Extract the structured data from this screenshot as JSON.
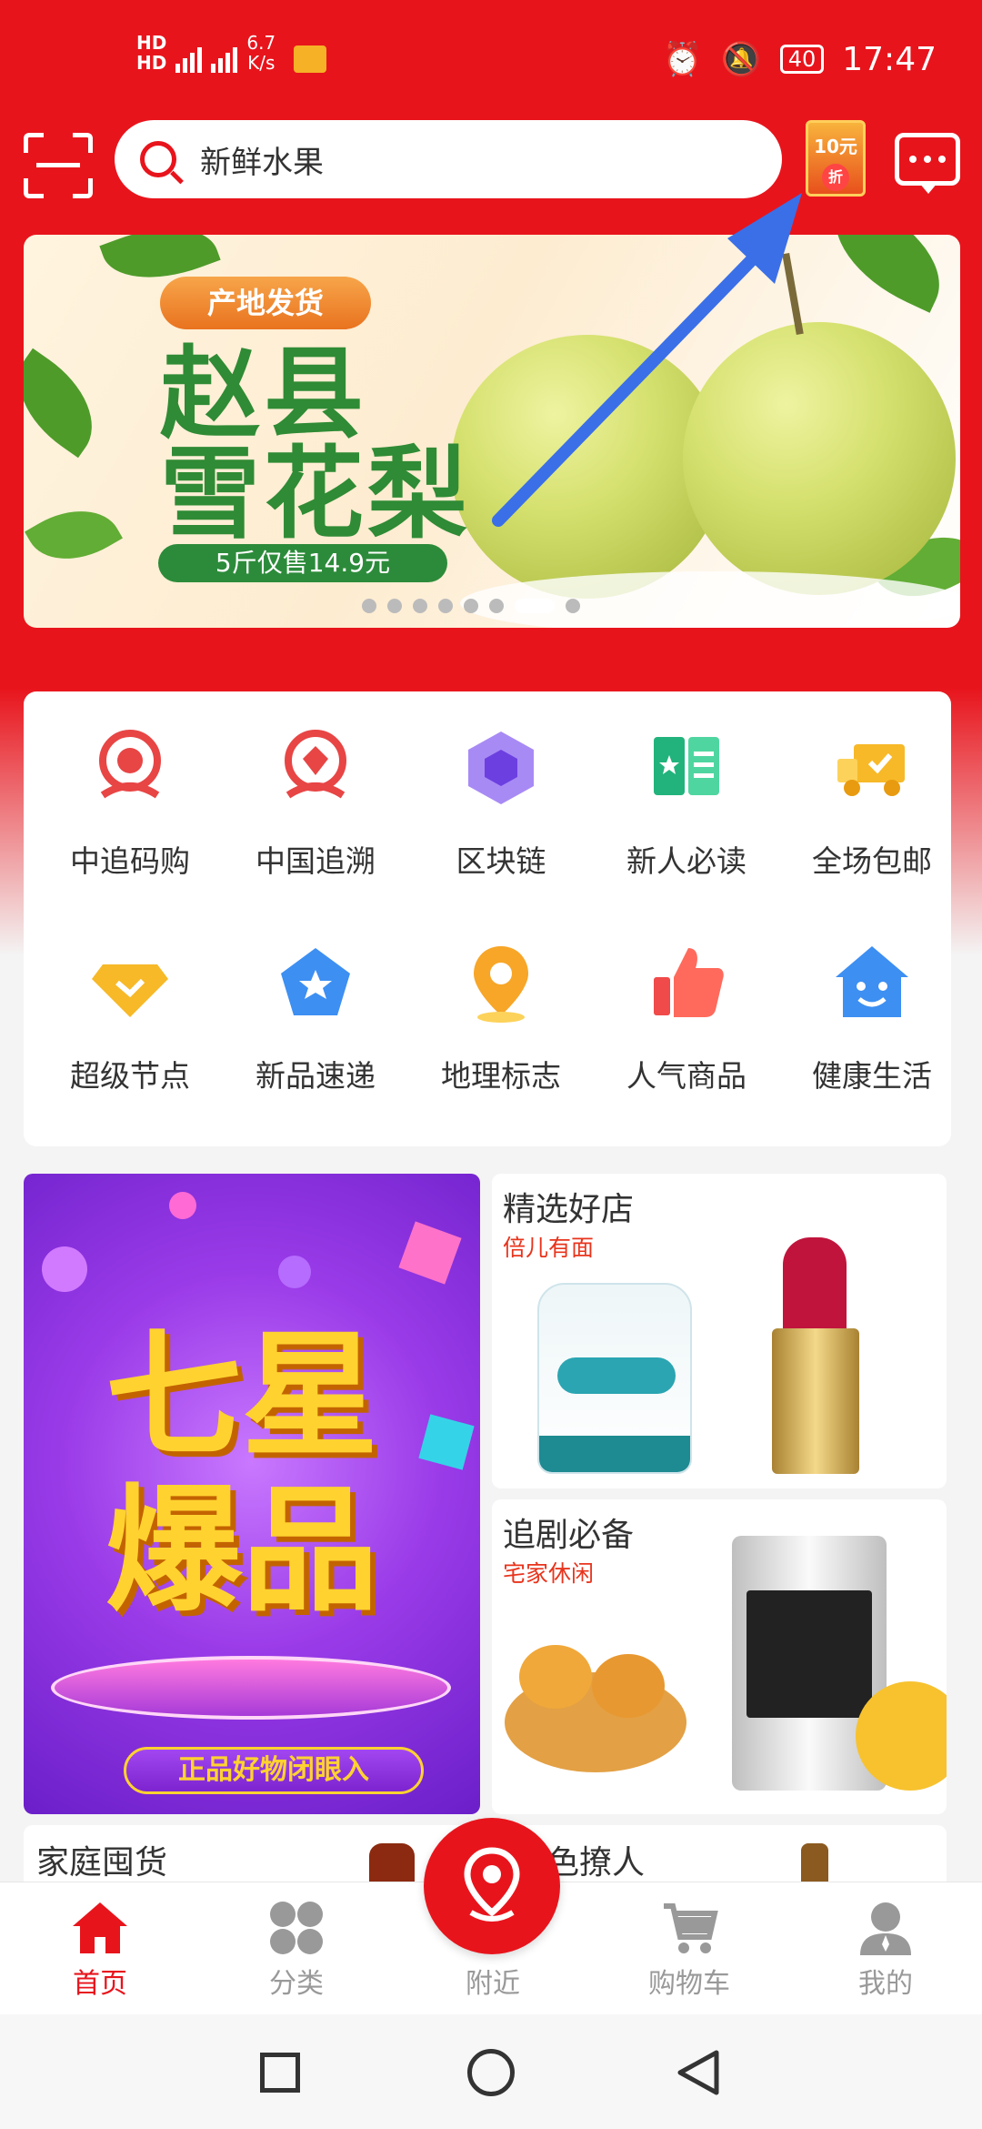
{
  "status_bar": {
    "network_left": "HD",
    "speed_value": "6.7",
    "speed_unit": "K/s",
    "battery": "40",
    "time": "17:47"
  },
  "header": {
    "search_placeholder": "新鲜水果",
    "coupon_amount": "10元",
    "coupon_badge": "折"
  },
  "banner": {
    "tag": "产地发货",
    "title_line1": "赵县",
    "title_line2": "雪花梨",
    "price_text": "5斤仅售14.9元",
    "dots_count": 8,
    "active_dot": 7
  },
  "grid": {
    "items": [
      {
        "label": "中追码购",
        "icon": "badge-emblem-icon",
        "color": "#e84545"
      },
      {
        "label": "中国追溯",
        "icon": "diamond-emblem-icon",
        "color": "#e84545"
      },
      {
        "label": "区块链",
        "icon": "blockchain-cube-icon",
        "color": "#8a5cf0"
      },
      {
        "label": "新人必读",
        "icon": "open-book-icon",
        "color": "#25c28a"
      },
      {
        "label": "全场包邮",
        "icon": "delivery-truck-icon",
        "color": "#f7b928"
      },
      {
        "label": "超级节点",
        "icon": "diamond-check-icon",
        "color": "#f7b928"
      },
      {
        "label": "新品速递",
        "icon": "star-tag-icon",
        "color": "#3d8ff2"
      },
      {
        "label": "地理标志",
        "icon": "location-pin-icon",
        "color": "#f7a628"
      },
      {
        "label": "人气商品",
        "icon": "thumbs-up-icon",
        "color": "#f04a4a"
      },
      {
        "label": "健康生活",
        "icon": "smile-house-icon",
        "color": "#3d8ff2"
      }
    ]
  },
  "promo": {
    "big_text_1": "七星",
    "big_text_2": "爆品",
    "button": "正品好物闭眼入",
    "shop_title": "精选好店",
    "shop_sub": "倍儿有面",
    "drama_title": "追剧必备",
    "drama_sub": "宅家休闲",
    "family_title": "家庭囤货",
    "beauty_title_partial": "色撩人"
  },
  "nav": {
    "items": [
      {
        "label": "首页",
        "icon": "home-icon",
        "active": true
      },
      {
        "label": "分类",
        "icon": "category-grid-icon",
        "active": false
      },
      {
        "label": "附近",
        "icon": "location-pin-icon",
        "active": false
      },
      {
        "label": "购物车",
        "icon": "cart-icon",
        "active": false
      },
      {
        "label": "我的",
        "icon": "profile-icon",
        "active": false
      }
    ]
  },
  "colors": {
    "brand_red": "#e8141c",
    "arrow_blue": "#3a6fe8"
  }
}
